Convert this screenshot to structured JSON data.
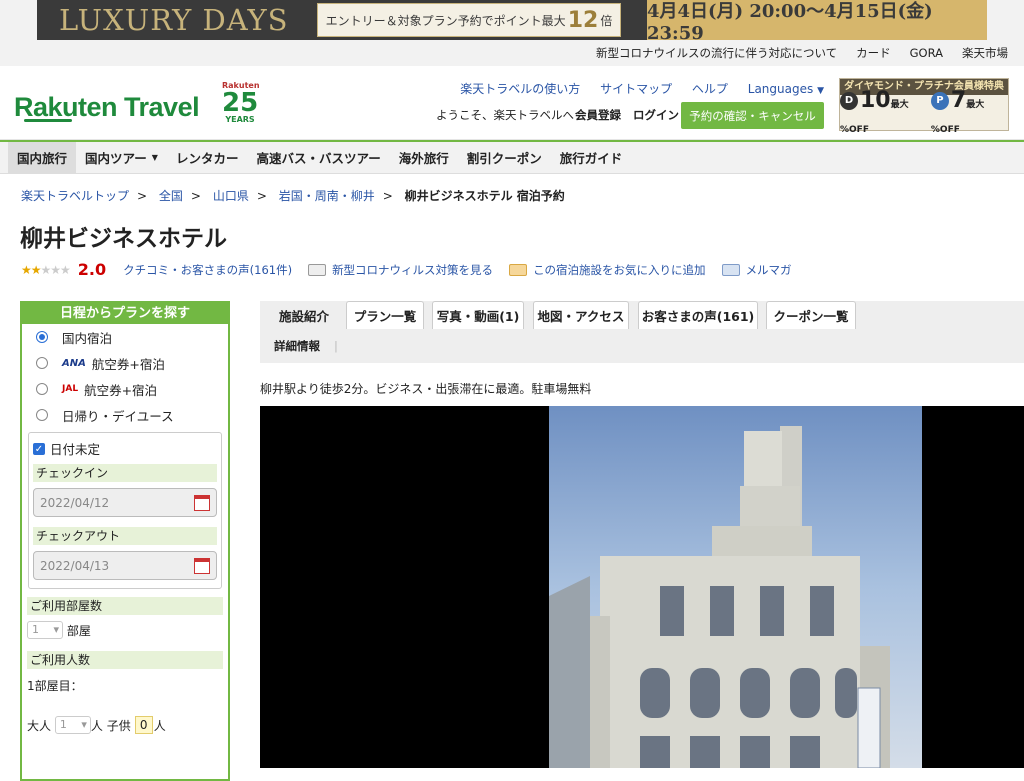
{
  "banner": {
    "title": "LUXURY DAYS",
    "entry_pre": "エントリー＆対象プラン予約でポイント最大",
    "entry_num": "12",
    "entry_post": "倍",
    "dates": "4月4日(月) 20:00～4月15日(金) 23:59"
  },
  "util": {
    "links": [
      "新型コロナウイルスの流行に伴う対応について",
      "カード",
      "GORA",
      "楽天市場"
    ]
  },
  "header": {
    "logo": "Rakuten Travel",
    "badge_r": "Rakuten",
    "badge_n": "25",
    "badge_y": "YEARS",
    "links": [
      "楽天トラベルの使い方",
      "サイトマップ",
      "ヘルプ",
      "Languages"
    ],
    "welcome": "ようこそ、楽天トラベルへ",
    "register": "会員登録",
    "login": "ログイン",
    "confirm": "予約の確認・キャンセル",
    "promo_title": "ダイヤモンド・プラチナ会員様特典",
    "promo_d": "10",
    "promo_p": "7",
    "promo_unit": "最大 %OFF"
  },
  "nav": {
    "items": [
      "国内旅行",
      "国内ツアー",
      "レンタカー",
      "高速バス・バスツアー",
      "海外旅行",
      "割引クーポン",
      "旅行ガイド"
    ]
  },
  "breadcrumb": [
    "楽天トラベルトップ",
    "全国",
    "山口県",
    "岩国・周南・柳井",
    "柳井ビジネスホテル 宿泊予約"
  ],
  "hotel": {
    "name": "柳井ビジネスホテル",
    "score": "2.0",
    "stars": 2,
    "reviews": "クチコミ・お客さまの声(161件)",
    "covid": "新型コロナウィルス対策を見る",
    "favorite": "この宿泊施設をお気に入りに追加",
    "mail": "メルマガ",
    "description": "柳井駅より徒歩2分。ビジネス・出張滞在に最適。駐車場無料"
  },
  "sidebar": {
    "header": "日程からプランを探す",
    "options": [
      {
        "label": "国内宿泊",
        "logo": ""
      },
      {
        "label": "航空券+宿泊",
        "logo": "ANA"
      },
      {
        "label": "航空券+宿泊",
        "logo": "JAL"
      },
      {
        "label": "日帰り・デイユース",
        "logo": ""
      }
    ],
    "undecided": "日付未定",
    "checkin_label": "チェックイン",
    "checkin": "2022/04/12",
    "checkout_label": "チェックアウト",
    "checkout": "2022/04/13",
    "rooms_label": "ご利用部屋数",
    "rooms": "1",
    "rooms_unit": "部屋",
    "people_label": "ご利用人数",
    "room1": "1部屋目：",
    "adult_label": "大人",
    "adults": "1",
    "person_unit": "人",
    "child_label": "子供",
    "children": "0"
  },
  "tabs": {
    "items": [
      "施設紹介",
      "プラン一覧",
      "写真・動画(1)",
      "地図・アクセス",
      "お客さまの声(161)",
      "クーポン一覧"
    ],
    "sub": "詳細情報"
  }
}
